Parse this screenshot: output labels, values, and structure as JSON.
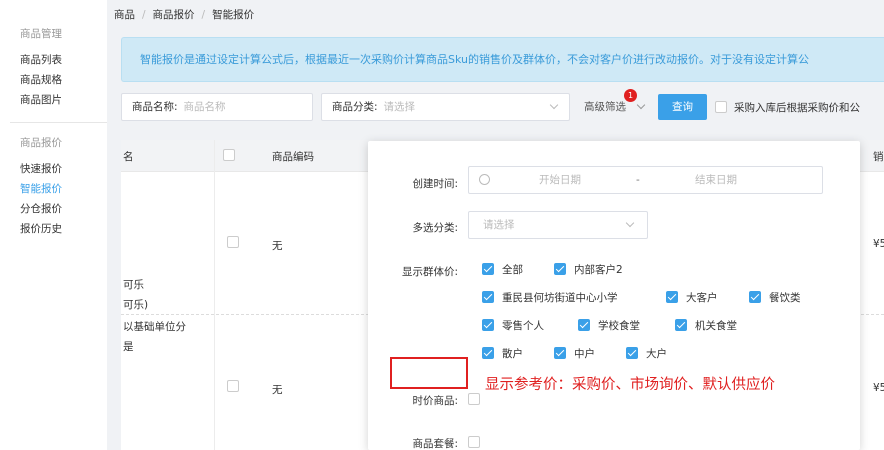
{
  "sidebar": {
    "groups": [
      {
        "title": "商品管理",
        "items": [
          "商品列表",
          "商品规格",
          "商品图片"
        ]
      },
      {
        "title": "商品报价",
        "items": [
          "快速报价",
          "智能报价",
          "分仓报价",
          "报价历史"
        ]
      }
    ],
    "active_item": "智能报价"
  },
  "breadcrumb": [
    "商品",
    "商品报价",
    "智能报价"
  ],
  "notice": "智能报价是通过设定计算公式后，根据最近一次采购价计算商品Sku的销售价及群体价，不会对客户价进行改动报价。对于没有设定计算公",
  "filters": {
    "name_label": "商品名称:",
    "name_placeholder": "商品名称",
    "category_label": "商品分类:",
    "category_placeholder": "请选择",
    "advanced_label": "高级筛选",
    "advanced_badge": "1",
    "query_label": "查询",
    "auto_quote_label": "采购入库后根据采购价和公"
  },
  "table": {
    "headers": {
      "name": "名",
      "code": "商品编码",
      "sales": "销"
    },
    "rows": [
      {
        "code": "无",
        "price": "¥5",
        "name_lines": [
          "可乐",
          "可乐)",
          "以基础单位分",
          "是"
        ]
      },
      {
        "code": "无",
        "price": "¥5"
      }
    ]
  },
  "advanced_panel": {
    "created_time_label": "创建时间:",
    "start_placeholder": "开始日期",
    "range_sep": "-",
    "end_placeholder": "结束日期",
    "multi_category_label": "多选分类:",
    "multi_category_placeholder": "请选择",
    "group_price_label": "显示群体价:",
    "group_options": [
      [
        "全部",
        "内部客户2"
      ],
      [
        "重民县何坊街道中心小学",
        "大客户",
        "餐饮类"
      ],
      [
        "零售个人",
        "学校食堂",
        "机关食堂"
      ],
      [
        "散户",
        "中户",
        "大户"
      ]
    ],
    "time_price_label": "时价商品:",
    "bundle_label": "商品套餐:"
  },
  "annotation": "显示参考价：采购价、市场询价、默认供应价",
  "colors": {
    "accent": "#3aa0e8",
    "annotation_red": "#e02020",
    "notice_bg": "#cfe9f6"
  }
}
